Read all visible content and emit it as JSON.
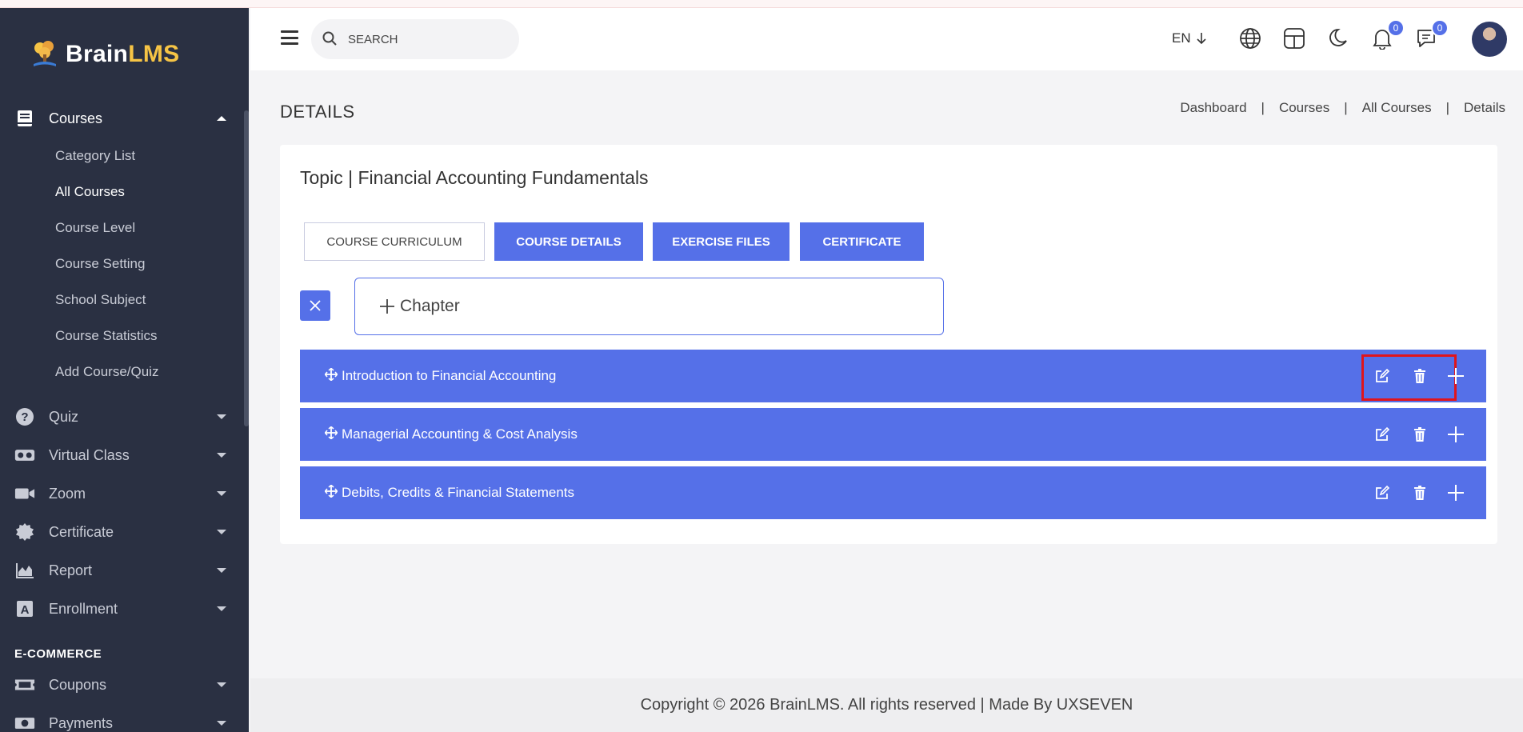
{
  "brand": {
    "name_part1": "Brain",
    "name_part2": "LMS"
  },
  "sidebar": {
    "courses": {
      "label": "Courses",
      "sub_items": [
        "Category List",
        "All Courses",
        "Course Level",
        "Course Setting",
        "School Subject",
        "Course Statistics",
        "Add Course/Quiz"
      ]
    },
    "items": [
      {
        "label": "Quiz",
        "icon": "question-icon"
      },
      {
        "label": "Virtual Class",
        "icon": "vr-headset-icon"
      },
      {
        "label": "Zoom",
        "icon": "video-camera-icon"
      },
      {
        "label": "Certificate",
        "icon": "certificate-icon"
      },
      {
        "label": "Report",
        "icon": "area-chart-icon"
      },
      {
        "label": "Enrollment",
        "icon": "letter-a-icon"
      }
    ],
    "section": "E-COMMERCE",
    "commerce_items": [
      {
        "label": "Coupons",
        "icon": "ticket-icon"
      },
      {
        "label": "Payments",
        "icon": "money-icon"
      }
    ]
  },
  "header": {
    "search_placeholder": "SEARCH",
    "language": "EN",
    "notifications_count": "0",
    "messages_count": "0"
  },
  "page": {
    "title": "DETAILS",
    "breadcrumb": [
      "Dashboard",
      "Courses",
      "All Courses",
      "Details"
    ],
    "breadcrumb_sep": "|"
  },
  "card": {
    "title": "Topic | Financial Accounting Fundamentals",
    "tabs": [
      "COURSE CURRICULUM",
      "COURSE DETAILS",
      "EXERCISE FILES",
      "CERTIFICATE"
    ],
    "chapter_label": "Chapter",
    "chapters": [
      "Introduction to Financial Accounting",
      "Managerial Accounting & Cost Analysis",
      "Debits, Credits & Financial Statements"
    ]
  },
  "footer": {
    "text": "Copyright © 2026 BrainLMS. All rights reserved | Made By UXSEVEN"
  },
  "colors": {
    "primary": "#5570e8",
    "sidebar_bg": "#2a3042",
    "highlight": "#e0141c",
    "brand_accent": "#f6c445"
  }
}
